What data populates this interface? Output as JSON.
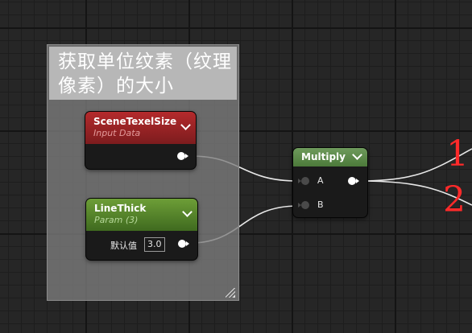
{
  "comment": {
    "title": "获取单位纹素（纹理像素）的大小"
  },
  "nodes": {
    "scene_texel_size": {
      "title": "SceneTexelSize",
      "subtitle": "Input Data",
      "color": "#9a1f22"
    },
    "line_thick": {
      "title": "LineThick",
      "subtitle": "Param (3)",
      "default_label": "默认值",
      "default_value": "3.0",
      "color": "#4c7a26"
    },
    "multiply": {
      "title": "Multiply",
      "input_a": "A",
      "input_b": "B",
      "color": "#5b8a4a"
    }
  },
  "annotations": {
    "first": "1",
    "second": "2"
  }
}
